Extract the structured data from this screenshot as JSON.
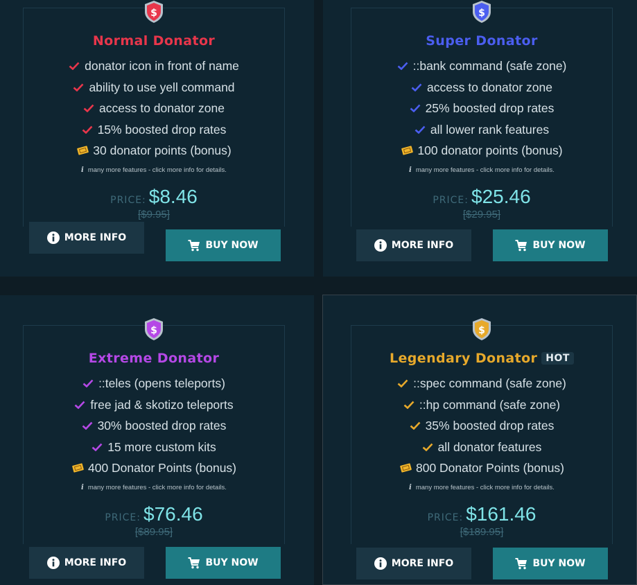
{
  "colors": {
    "normal": "#e8364b",
    "super": "#4b5ef0",
    "extreme": "#b548e6",
    "legendary": "#e7a92b",
    "price": "#7fe3e7",
    "muted": "#3f6a79",
    "buy_button": "#1e7b84",
    "info_button": "#1b3644"
  },
  "cards": [
    {
      "title": "Normal Donator",
      "icon": "dollar-shield-icon",
      "features": [
        "donator icon in front of name",
        "ability to use yell command",
        "access to donator zone",
        "15% boosted drop rates"
      ],
      "bonus": "30 donator points (bonus)",
      "note": "many more features - click more info for details.",
      "price_label": "PRICE:",
      "price": "$8.46",
      "old_price": "[$9.95]",
      "more_info": "MORE INFO",
      "buy_now": "BUY NOW"
    },
    {
      "title": "Super Donator",
      "icon": "dollar-shield-icon",
      "features": [
        "::bank command (safe zone)",
        "access to donator zone",
        "25% boosted drop rates",
        "all lower rank features"
      ],
      "bonus": "100 donator points (bonus)",
      "note": "many more features - click more info for details.",
      "price_label": "PRICE:",
      "price": "$25.46",
      "old_price": "[$29.95]",
      "more_info": "MORE INFO",
      "buy_now": "BUY NOW"
    },
    {
      "title": "Extreme Donator",
      "icon": "dollar-shield-icon",
      "features": [
        "::teles (opens teleports)",
        "free jad & skotizo teleports",
        "30% boosted drop rates",
        "15 more custom kits"
      ],
      "bonus": "400 Donator Points (bonus)",
      "note": "many more features - click more info for details.",
      "price_label": "PRICE:",
      "price": "$76.46",
      "old_price": "[$89.95]",
      "more_info": "MORE INFO",
      "buy_now": "BUY NOW"
    },
    {
      "title": "Legendary Donator",
      "badge": "HOT",
      "icon": "dollar-shield-icon",
      "features": [
        "::spec command (safe zone)",
        "::hp command (safe zone)",
        "35% boosted drop rates",
        "all donator features"
      ],
      "bonus": "800 Donator Points (bonus)",
      "note": "many more features - click more info for details.",
      "price_label": "PRICE:",
      "price": "$161.46",
      "old_price": "[$189.95]",
      "more_info": "MORE INFO",
      "buy_now": "BUY NOW"
    }
  ]
}
